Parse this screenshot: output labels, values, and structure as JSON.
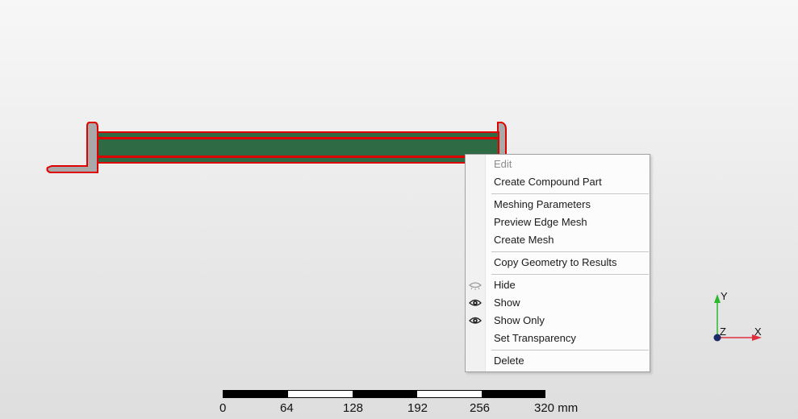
{
  "context_menu": {
    "items": [
      {
        "label": "Edit",
        "enabled": false,
        "icon": ""
      },
      {
        "label": "Create Compound Part",
        "enabled": true,
        "icon": ""
      },
      {
        "label": "Meshing Parameters",
        "enabled": true,
        "icon": ""
      },
      {
        "label": "Preview Edge Mesh",
        "enabled": true,
        "icon": ""
      },
      {
        "label": "Create Mesh",
        "enabled": true,
        "icon": ""
      },
      {
        "label": "Copy Geometry to Results",
        "enabled": true,
        "icon": ""
      },
      {
        "label": "Hide",
        "enabled": true,
        "icon": "eye-closed-icon"
      },
      {
        "label": "Show",
        "enabled": true,
        "icon": "eye-icon"
      },
      {
        "label": "Show Only",
        "enabled": true,
        "icon": "eye-icon"
      },
      {
        "label": "Set Transparency",
        "enabled": true,
        "icon": ""
      },
      {
        "label": "Delete",
        "enabled": true,
        "icon": ""
      }
    ]
  },
  "scale_bar": {
    "ticks": [
      "0",
      "64",
      "128",
      "192",
      "256",
      "320 mm"
    ]
  },
  "axis_triad": {
    "y_label": "Y",
    "z_label": "Z",
    "x_label": "X",
    "y_color": "#2db82d",
    "x_color": "#e03040",
    "z_color": "#1a2a6a"
  },
  "colors": {
    "background_top": "#f7f7f7",
    "background_bottom": "#dedede",
    "part_fill": "#2e6b45",
    "part_outline": "#e00000",
    "bracket_fill": "#a9a9a9"
  }
}
